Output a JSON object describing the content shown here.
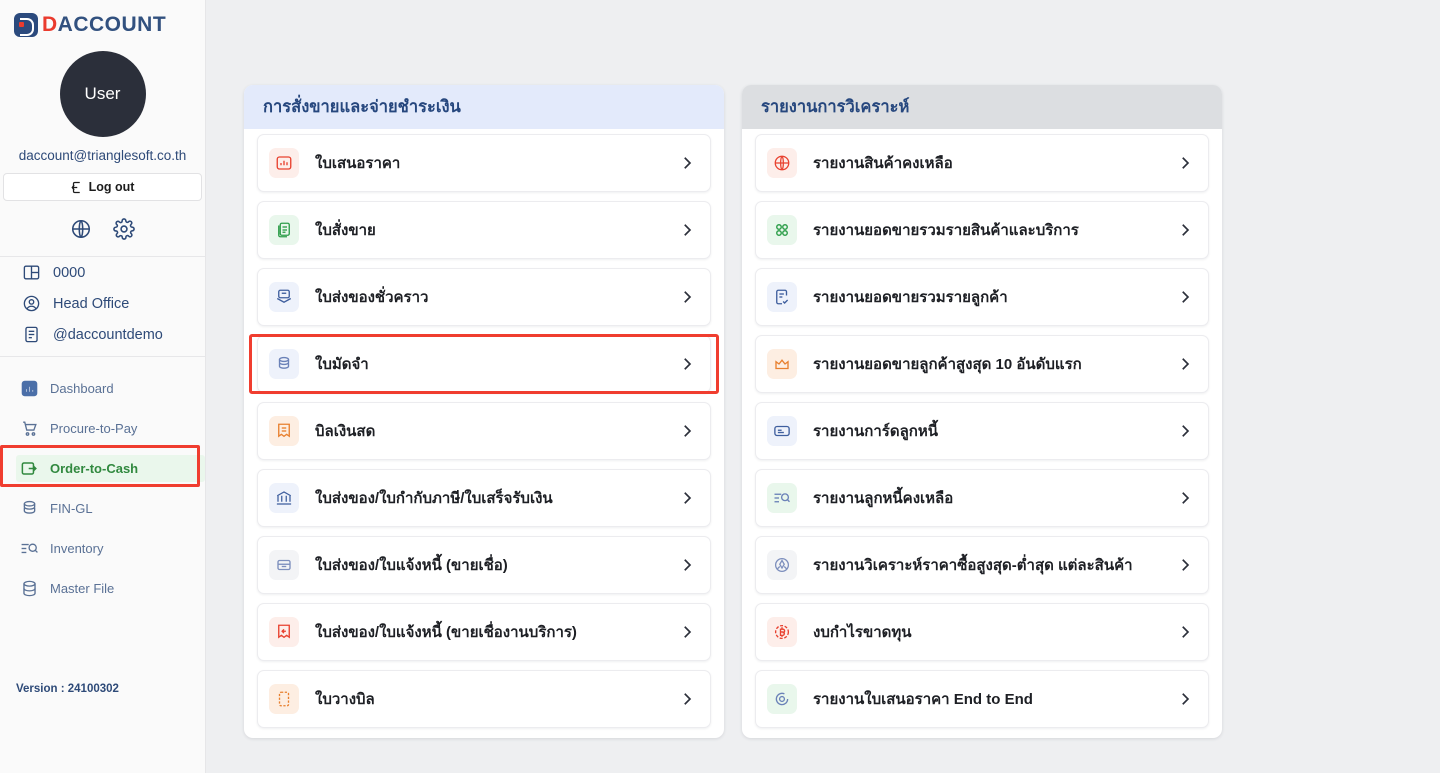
{
  "brand": {
    "name_part1": "D",
    "name_part2": "ACCOUNT",
    "logo_icon": "daccount-logo-icon"
  },
  "sidebar": {
    "avatar_label": "User",
    "user_email": "daccount@trianglesoft.co.th",
    "logout_label": "Log out",
    "quick_actions": [
      {
        "name": "language-globe-icon"
      },
      {
        "name": "settings-gear-icon"
      }
    ],
    "context_items": [
      {
        "label": "0000",
        "icon": "branch-icon"
      },
      {
        "label": "Head Office",
        "icon": "user-circle-icon"
      },
      {
        "label": "@daccountdemo",
        "icon": "document-icon"
      }
    ],
    "nav_items": [
      {
        "label": "Dashboard",
        "icon": "dashboard-icon",
        "active": false
      },
      {
        "label": "Procure-to-Pay",
        "icon": "cart-icon",
        "active": false
      },
      {
        "label": "Order-to-Cash",
        "icon": "order-to-cash-icon",
        "active": true
      },
      {
        "label": "FIN-GL",
        "icon": "coins-icon",
        "active": false
      },
      {
        "label": "Inventory",
        "icon": "inventory-search-icon",
        "active": false
      },
      {
        "label": "Master File",
        "icon": "database-icon",
        "active": false
      }
    ],
    "version": "Version : 24100302"
  },
  "panels": [
    {
      "title": "การสั่งขายและจ่ายชำระเงิน",
      "header_color": "#e3eafb",
      "items": [
        {
          "label": "ใบเสนอราคา",
          "icon": "quotation-chart-icon",
          "icon_bg": "bg-red",
          "icon_color": "#e8412f"
        },
        {
          "label": "ใบสั่งขาย",
          "icon": "sales-order-icon",
          "icon_bg": "bg-green",
          "icon_color": "#2e9e4a"
        },
        {
          "label": "ใบส่งของชั่วคราว",
          "icon": "temporary-delivery-icon",
          "icon_bg": "bg-blue",
          "icon_color": "#3f5f9e"
        },
        {
          "label": "ใบมัดจำ",
          "icon": "deposit-coins-icon",
          "icon_bg": "bg-blue",
          "icon_color": "#6b82b8",
          "highlighted": true
        },
        {
          "label": "บิลเงินสด",
          "icon": "cash-bill-icon",
          "icon_bg": "bg-orange",
          "icon_color": "#e8802f"
        },
        {
          "label": "ใบส่งของ/ใบกำกับภาษี/ใบเสร็จรับเงิน",
          "icon": "tax-invoice-bank-icon",
          "icon_bg": "bg-blue",
          "icon_color": "#3f5f9e"
        },
        {
          "label": "ใบส่งของ/ใบแจ้งหนี้ (ขายเชื่อ)",
          "icon": "credit-invoice-icon",
          "icon_bg": "bg-gray",
          "icon_color": "#7d8fbd"
        },
        {
          "label": "ใบส่งของ/ใบแจ้งหนี้ (ขายเชื่องานบริการ)",
          "icon": "service-credit-invoice-icon",
          "icon_bg": "bg-red",
          "icon_color": "#e8412f"
        },
        {
          "label": "ใบวางบิล",
          "icon": "billing-note-icon",
          "icon_bg": "bg-orange",
          "icon_color": "#e8802f"
        }
      ]
    },
    {
      "title": "รายงานการวิเคราะห์",
      "header_color": "#dcdee1",
      "items": [
        {
          "label": "รายงานสินค้าคงเหลือ",
          "icon": "globe-inventory-icon",
          "icon_bg": "bg-red",
          "icon_color": "#e8412f"
        },
        {
          "label": "รายงานยอดขายรวมรายสินค้าและบริการ",
          "icon": "grid-dots-icon",
          "icon_bg": "bg-green",
          "icon_color": "#2e9e4a"
        },
        {
          "label": "รายงานยอดขายรวมรายลูกค้า",
          "icon": "document-check-icon",
          "icon_bg": "bg-blue",
          "icon_color": "#3f5f9e"
        },
        {
          "label": "รายงานยอดขายลูกค้าสูงสุด 10 อันดับแรก",
          "icon": "crown-icon",
          "icon_bg": "bg-orange",
          "icon_color": "#e8802f"
        },
        {
          "label": "รายงานการ์ดลูกหนี้",
          "icon": "card-icon",
          "icon_bg": "bg-blue",
          "icon_color": "#3f5f9e"
        },
        {
          "label": "รายงานลูกหนี้คงเหลือ",
          "icon": "list-search-icon",
          "icon_bg": "bg-green",
          "icon_color": "#6b82b8"
        },
        {
          "label": "รายงานวิเคราะห์ราคาซื้อสูงสุด-ต่ำสุด แต่ละสินค้า",
          "icon": "price-analysis-icon",
          "icon_bg": "bg-gray",
          "icon_color": "#7d8fbd"
        },
        {
          "label": "งบกำไรขาดทุน",
          "icon": "profit-loss-baht-icon",
          "icon_bg": "bg-red",
          "icon_color": "#e8412f"
        },
        {
          "label": "รายงานใบเสนอราคา End to End",
          "icon": "end-to-end-target-icon",
          "icon_bg": "bg-green",
          "icon_color": "#6b82b8"
        }
      ]
    }
  ],
  "highlights": {
    "color": "#f03d2f",
    "row_highlight_label": "ใบมัดจำ",
    "nav_highlight_label": "Order-to-Cash"
  }
}
